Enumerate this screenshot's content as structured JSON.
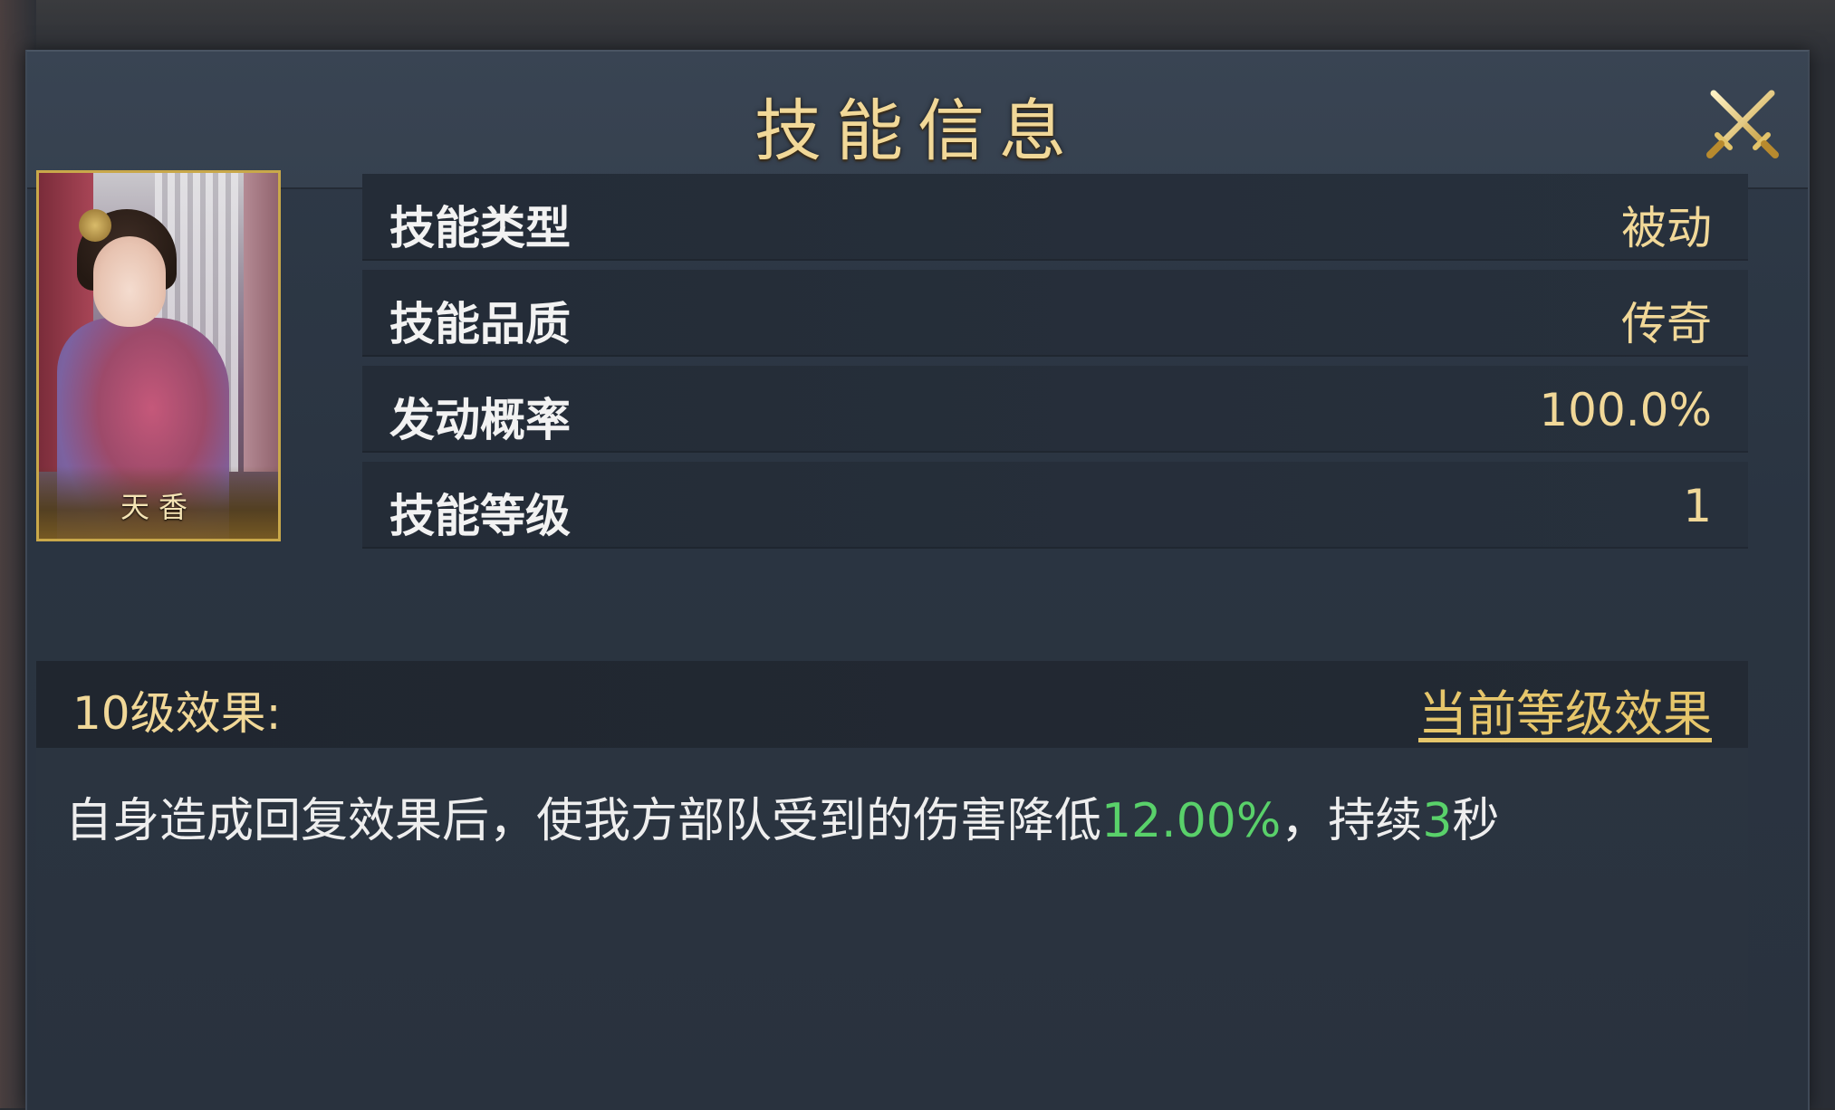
{
  "dialog": {
    "title": "技能信息",
    "close_icon": "crossed-swords-icon"
  },
  "portrait": {
    "name": "天香",
    "frame_color": "#c9a84a"
  },
  "info_rows": [
    {
      "label": "技能类型",
      "value": "被动"
    },
    {
      "label": "技能品质",
      "value": "传奇"
    },
    {
      "label": "发动概率",
      "value": "100.0%"
    },
    {
      "label": "技能等级",
      "value": "1"
    }
  ],
  "effect": {
    "level_label": "10级效果:",
    "current_level_link": "当前等级效果",
    "text_part1": "自身造成回复效果后，使我方部队受到的伤害降低",
    "highlight_percent": "12.00%",
    "text_part2": "，持续",
    "highlight_duration": "3",
    "text_part3": "秒"
  },
  "colors": {
    "title_gold": "#f1d898",
    "highlight_green": "#59d16a",
    "label_white": "#f2f2f2"
  }
}
